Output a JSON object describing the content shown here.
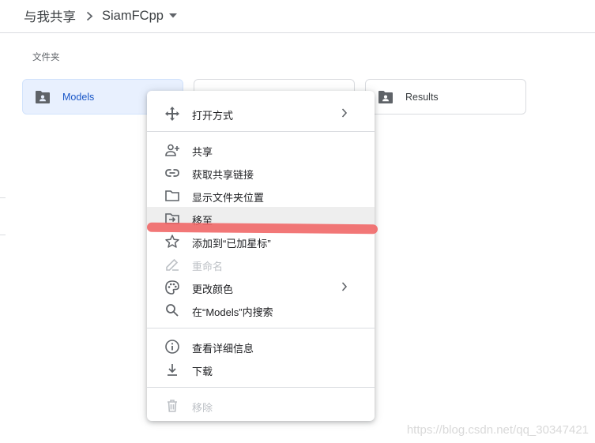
{
  "breadcrumb": {
    "root": "与我共享",
    "current": "SiamFCpp"
  },
  "section": {
    "folders_label": "文件夹"
  },
  "folders": [
    {
      "name": "Models",
      "selected": true
    },
    {
      "name": "",
      "selected": false
    },
    {
      "name": "Results",
      "selected": false
    }
  ],
  "context_menu": {
    "groups": [
      [
        {
          "label": "打开方式",
          "icon": "open-with-icon",
          "submenu": true,
          "disabled": false,
          "highlighted": false
        }
      ],
      [
        {
          "label": "共享",
          "icon": "person-add-icon",
          "submenu": false,
          "disabled": false,
          "highlighted": false
        },
        {
          "label": "获取共享链接",
          "icon": "link-icon",
          "submenu": false,
          "disabled": false,
          "highlighted": false
        },
        {
          "label": "显示文件夹位置",
          "icon": "folder-outline-icon",
          "submenu": false,
          "disabled": false,
          "highlighted": false
        },
        {
          "label": "移至",
          "icon": "move-to-icon",
          "submenu": false,
          "disabled": false,
          "highlighted": true
        },
        {
          "label": "添加到“已加星标”",
          "icon": "star-icon",
          "submenu": false,
          "disabled": false,
          "highlighted": false
        },
        {
          "label": "重命名",
          "icon": "pencil-icon",
          "submenu": false,
          "disabled": true,
          "highlighted": false
        },
        {
          "label": "更改颜色",
          "icon": "palette-icon",
          "submenu": true,
          "disabled": false,
          "highlighted": false
        },
        {
          "label": "在“Models”内搜索",
          "icon": "search-icon",
          "submenu": false,
          "disabled": false,
          "highlighted": false
        }
      ],
      [
        {
          "label": "查看详细信息",
          "icon": "info-icon",
          "submenu": false,
          "disabled": false,
          "highlighted": false
        },
        {
          "label": "下载",
          "icon": "download-icon",
          "submenu": false,
          "disabled": false,
          "highlighted": false
        }
      ],
      [
        {
          "label": "移除",
          "icon": "trash-icon",
          "submenu": false,
          "disabled": true,
          "highlighted": false
        }
      ]
    ]
  },
  "watermark": "https://blog.csdn.net/qq_30347421",
  "colors": {
    "selected_folder_bg": "#e8f0fe",
    "selected_folder_text": "#1a57c7",
    "menu_highlight": "#eeeeee",
    "disabled_text": "#bdc1c6",
    "annotation_stroke": "#f06464"
  }
}
